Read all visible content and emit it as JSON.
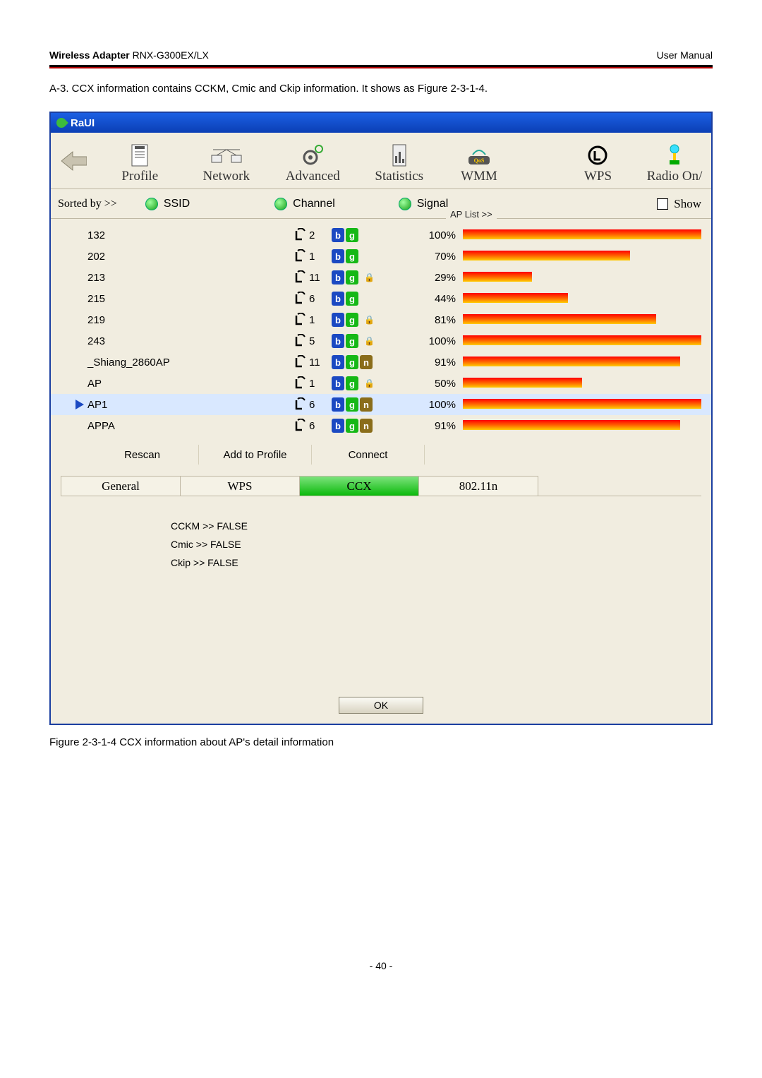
{
  "header": {
    "left_bold": "Wireless Adapter",
    "left_rest": " RNX-G300EX/LX",
    "right": "User Manual"
  },
  "desc": "A-3. CCX information contains CCKM, Cmic and Ckip information. It shows as Figure 2-3-1-4.",
  "app": {
    "title": "RaUI",
    "toolbar": {
      "profile": "Profile",
      "network": "Network",
      "advanced": "Advanced",
      "statistics": "Statistics",
      "wmm": "WMM",
      "wps": "WPS",
      "radio": "Radio On/"
    },
    "sort": {
      "label": "Sorted by >>",
      "ssid": "SSID",
      "channel": "Channel",
      "signal": "Signal",
      "show": "Show",
      "aplist": "AP List >>"
    },
    "rows": [
      {
        "sel": false,
        "ssid": "132",
        "ch": "2",
        "modes": [
          "b",
          "g"
        ],
        "lock": false,
        "sig": "100%",
        "pct": 100
      },
      {
        "sel": false,
        "ssid": "202",
        "ch": "1",
        "modes": [
          "b",
          "g"
        ],
        "lock": false,
        "sig": "70%",
        "pct": 70
      },
      {
        "sel": false,
        "ssid": "213",
        "ch": "11",
        "modes": [
          "b",
          "g"
        ],
        "lock": true,
        "sig": "29%",
        "pct": 29
      },
      {
        "sel": false,
        "ssid": "215",
        "ch": "6",
        "modes": [
          "b",
          "g"
        ],
        "lock": false,
        "sig": "44%",
        "pct": 44
      },
      {
        "sel": false,
        "ssid": "219",
        "ch": "1",
        "modes": [
          "b",
          "g"
        ],
        "lock": true,
        "sig": "81%",
        "pct": 81
      },
      {
        "sel": false,
        "ssid": "243",
        "ch": "5",
        "modes": [
          "b",
          "g"
        ],
        "lock": true,
        "sig": "100%",
        "pct": 100
      },
      {
        "sel": false,
        "ssid": "_Shiang_2860AP",
        "ch": "11",
        "modes": [
          "b",
          "g",
          "n"
        ],
        "lock": false,
        "sig": "91%",
        "pct": 91
      },
      {
        "sel": false,
        "ssid": "AP",
        "ch": "1",
        "modes": [
          "b",
          "g"
        ],
        "lock": true,
        "sig": "50%",
        "pct": 50
      },
      {
        "sel": true,
        "ssid": "AP1",
        "ch": "6",
        "modes": [
          "b",
          "g",
          "n"
        ],
        "lock": false,
        "sig": "100%",
        "pct": 100
      },
      {
        "sel": false,
        "ssid": "APPA",
        "ch": "6",
        "modes": [
          "b",
          "g",
          "n"
        ],
        "lock": false,
        "sig": "91%",
        "pct": 91
      }
    ],
    "buttons": {
      "rescan": "Rescan",
      "add": "Add to Profile",
      "connect": "Connect"
    },
    "tabs": {
      "general": "General",
      "wps": "WPS",
      "ccx": "CCX",
      "n": "802.11n"
    },
    "info": {
      "cckm": "CCKM >> FALSE",
      "cmic": "Cmic >> FALSE",
      "ckip": "Ckip >> FALSE"
    },
    "ok": "OK"
  },
  "caption": "Figure 2-3-1-4 CCX information about AP's detail information",
  "page_num": "- 40 -"
}
